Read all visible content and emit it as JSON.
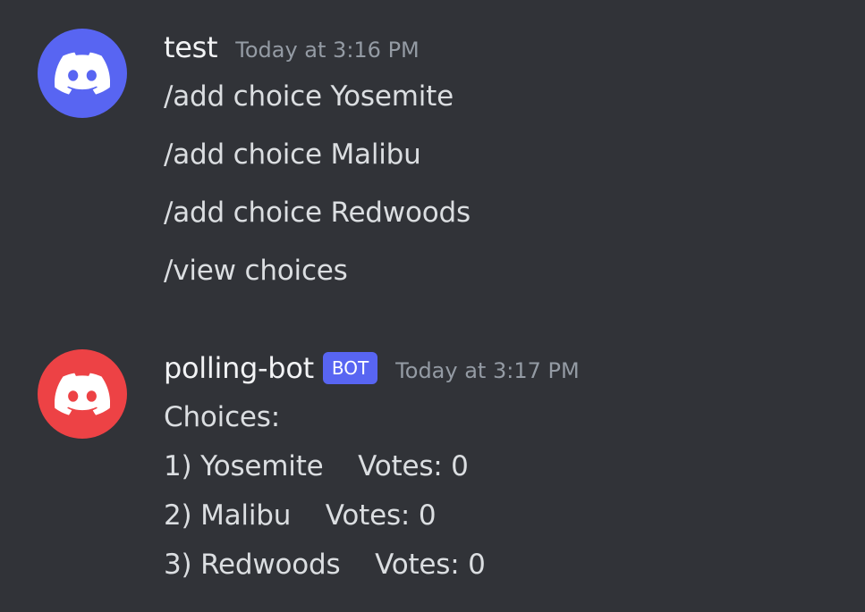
{
  "messages": [
    {
      "username": "test",
      "timestamp": "Today at 3:16 PM",
      "avatar": {
        "icon": "discord-logo-icon",
        "color": "#5865f2"
      },
      "lines": [
        "/add choice Yosemite",
        "/add choice Malibu",
        "/add choice Redwoods",
        "/view choices"
      ]
    },
    {
      "username": "polling-bot",
      "badge": "BOT",
      "timestamp": "Today at 3:17 PM",
      "avatar": {
        "icon": "discord-logo-icon",
        "color": "#ed4245"
      },
      "lines": [
        "Choices:",
        "1) Yosemite    Votes: 0",
        "2) Malibu    Votes: 0",
        "3) Redwoods    Votes: 0"
      ]
    }
  ],
  "theme": {
    "background": "#313338",
    "text": "#dbdee1",
    "username": "#f2f3f5",
    "muted": "#949ba4",
    "bot_badge": "#5865f2"
  }
}
